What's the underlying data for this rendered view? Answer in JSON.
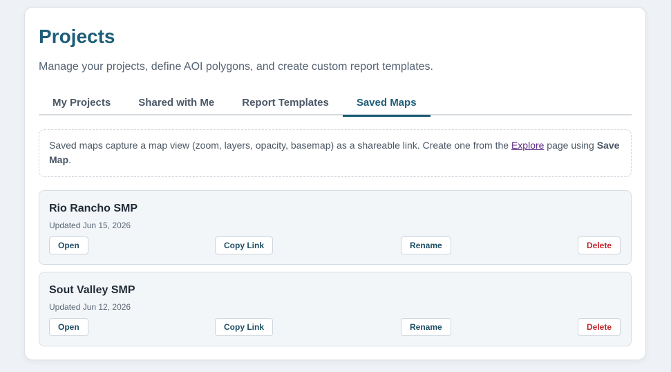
{
  "page": {
    "title": "Projects",
    "subtitle": "Manage your projects, define AOI polygons, and create custom report templates."
  },
  "tabs": [
    {
      "label": "My Projects",
      "active": false
    },
    {
      "label": "Shared with Me",
      "active": false
    },
    {
      "label": "Report Templates",
      "active": false
    },
    {
      "label": "Saved Maps",
      "active": true
    }
  ],
  "note": {
    "text_before": "Saved maps capture a map view (zoom, layers, opacity, basemap) as a shareable link. Create one from the ",
    "link_label": "Explore",
    "text_middle": " page using ",
    "bold_label": "Save Map",
    "text_after": "."
  },
  "saved_maps": [
    {
      "name": "Rio Rancho SMP",
      "updated": "Updated Jun 15, 2026",
      "actions": {
        "open": "Open",
        "copy_link": "Copy Link",
        "rename": "Rename",
        "delete": "Delete"
      }
    },
    {
      "name": "Sout Valley SMP",
      "updated": "Updated Jun 12, 2026",
      "actions": {
        "open": "Open",
        "copy_link": "Copy Link",
        "rename": "Rename",
        "delete": "Delete"
      }
    }
  ],
  "colors": {
    "accent": "#1e5d78",
    "danger": "#c0262d",
    "link": "#5b2a86"
  }
}
